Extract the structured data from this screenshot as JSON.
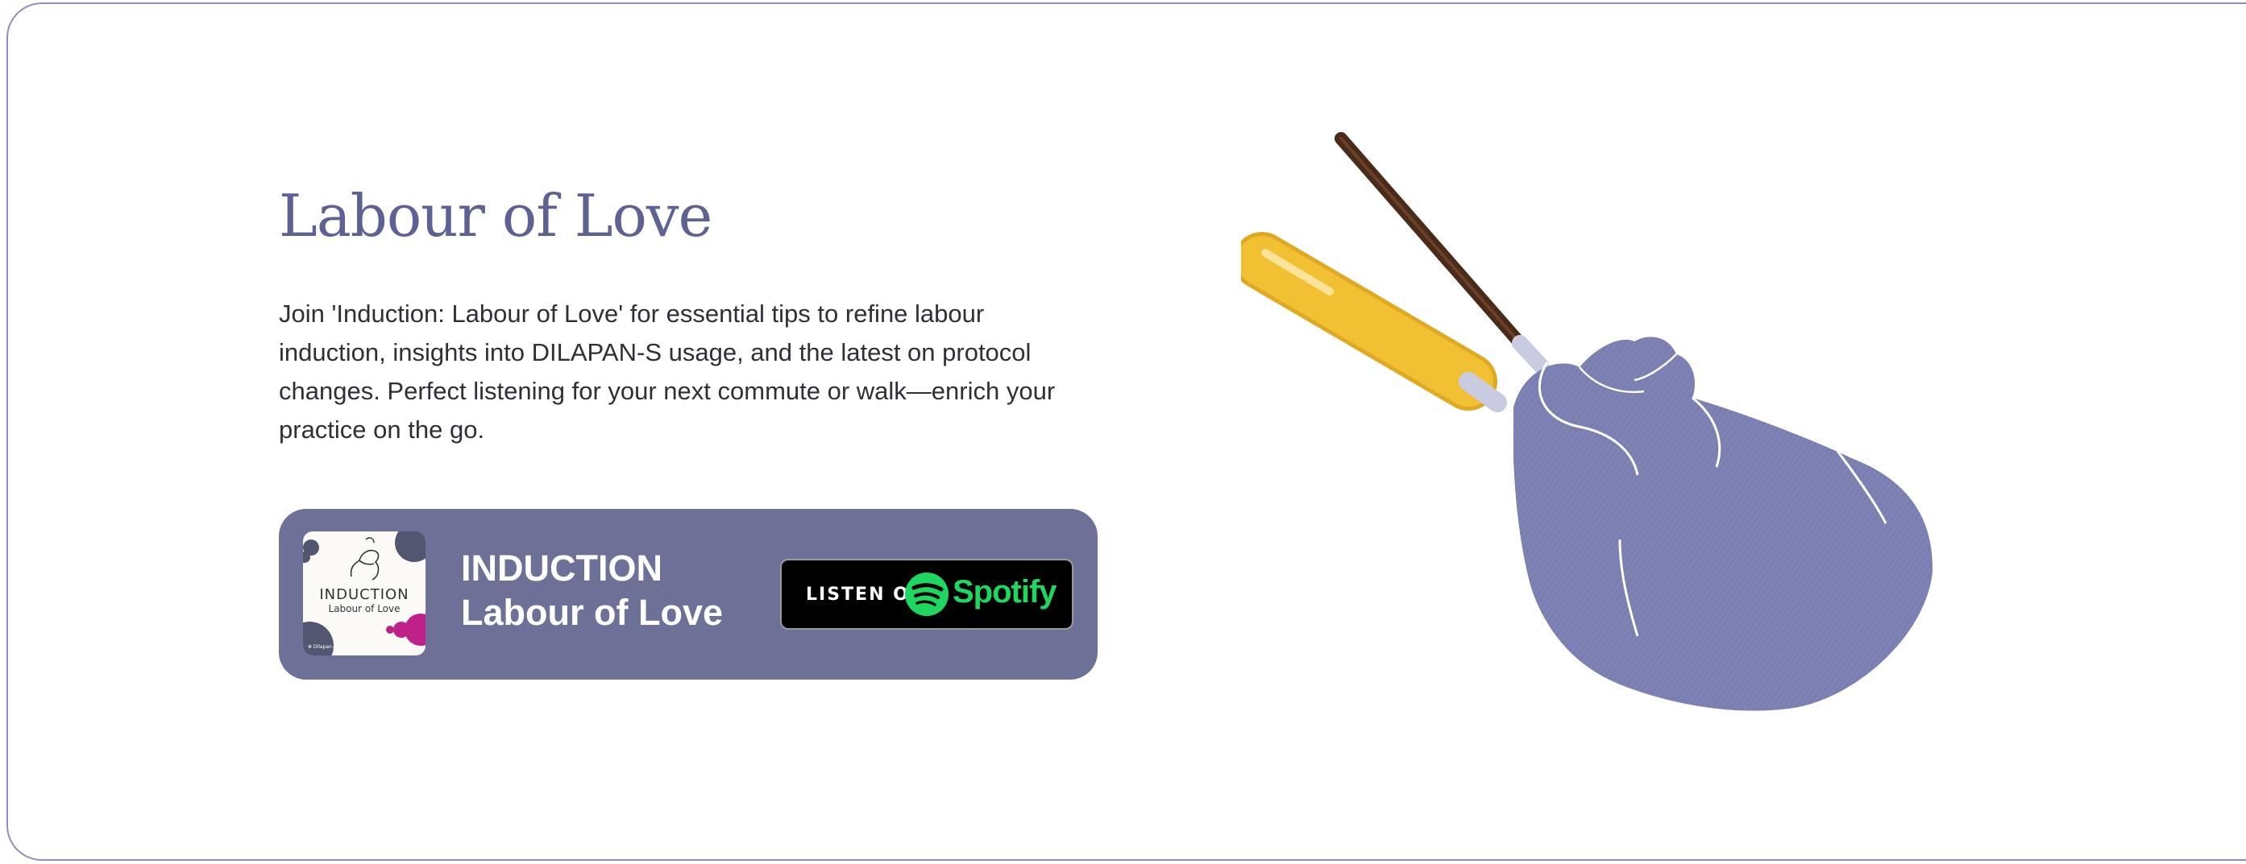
{
  "section": {
    "title": "Labour of Love",
    "description": "Join 'Induction: Labour of Love' for essential tips to refine labour induction, insights into DILAPAN-S usage, and the latest on protocol changes. Perfect listening for your next commute or walk—enrich your practice on the go."
  },
  "player": {
    "cover": {
      "title": "INDUCTION",
      "subtitle": "Labour of Love",
      "brand": "✻ Dilapan-S"
    },
    "name_line1": "INDUCTION",
    "name_line2": "Labour of Love",
    "button": {
      "prefix": "LISTEN ON",
      "service": "Spotify",
      "service_color": "#1ed760"
    }
  },
  "colors": {
    "accent": "#5e6193",
    "player_bg": "#6e7197",
    "hand": "#7a7eb0",
    "rod_handle": "#f2c033",
    "rod_tip": "#4a2a18"
  },
  "illustration": {
    "icon": "hand-holding-dilator-icon"
  }
}
